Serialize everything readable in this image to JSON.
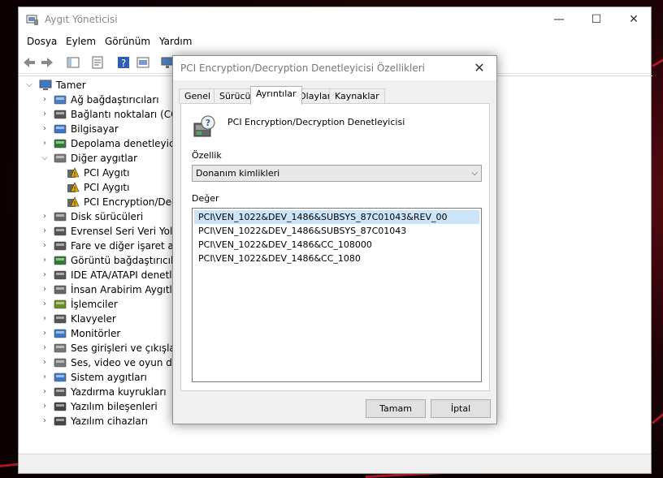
{
  "window": {
    "title": "Aygıt Yöneticisi",
    "minimize_icon": "—",
    "maximize_icon": "☐",
    "close_icon": "✕"
  },
  "menu": [
    "Dosya",
    "Eylem",
    "Görünüm",
    "Yardım"
  ],
  "tree": {
    "root": "Tamer",
    "categories": [
      "Ağ bağdaştırıcıları",
      "Bağlantı noktaları (COM",
      "Bilgisayar",
      "Depolama denetleyiciler",
      "Diğer aygıtlar",
      "PCI Aygıtı",
      "PCI Aygıtı",
      "PCI Encryption/Decr",
      "Disk sürücüleri",
      "Evrensel Seri Veri Yolu de",
      "Fare ve diğer işaret aygıt",
      "Görüntü bağdaştırıcıları",
      "IDE ATA/ATAPI denetleyi",
      "İnsan Arabirim Aygıtları",
      "İşlemciler",
      "Klavyeler",
      "Monitörler",
      "Ses girişleri ve çıkışları",
      "Ses, video ve oyun dene",
      "Sistem aygıtları",
      "Yazdırma kuyrukları",
      "Yazılım bileşenleri",
      "Yazılım cihazları"
    ]
  },
  "dialog": {
    "title": "PCI Encryption/Decryption Denetleyicisi Özellikleri",
    "close_icon": "✕",
    "tabs": [
      "Genel",
      "Sürücü",
      "Ayrıntılar",
      "Olaylar",
      "Kaynaklar"
    ],
    "active_tab": "Ayrıntılar",
    "device_name": "PCI Encryption/Decryption Denetleyicisi",
    "property_label": "Özellik",
    "property_value": "Donanım kimlikleri",
    "value_label": "Değer",
    "values": [
      "PCI\\VEN_1022&DEV_1486&SUBSYS_87C01043&REV_00",
      "PCI\\VEN_1022&DEV_1486&SUBSYS_87C01043",
      "PCI\\VEN_1022&DEV_1486&CC_108000",
      "PCI\\VEN_1022&DEV_1486&CC_1080"
    ],
    "ok_label": "Tamam",
    "cancel_label": "İptal"
  }
}
